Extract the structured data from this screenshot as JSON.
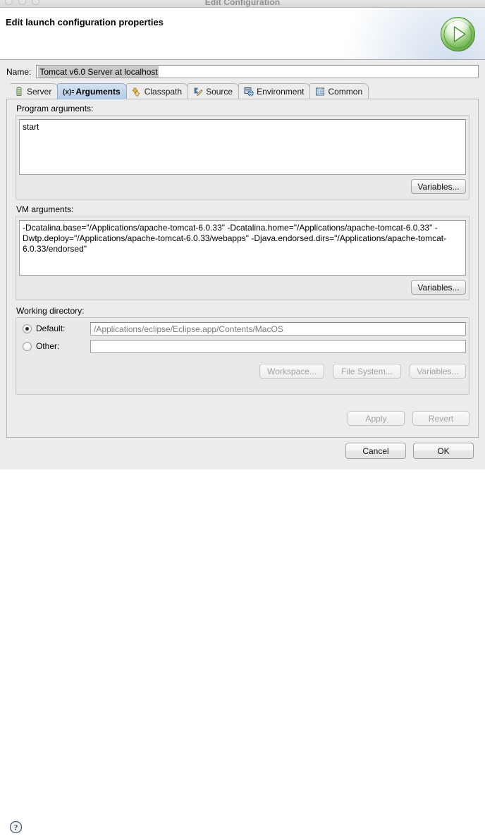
{
  "window": {
    "title": "Edit Configuration",
    "traffic_lights": [
      "close",
      "minimize",
      "zoom"
    ]
  },
  "banner": {
    "heading": "Edit launch configuration properties",
    "icon": "run-play-icon"
  },
  "name": {
    "label": "Name:",
    "value": "Tomcat v6.0 Server at localhost",
    "selected": true
  },
  "tabs": [
    {
      "id": "server",
      "label": "Server",
      "icon": "server-icon",
      "active": false
    },
    {
      "id": "arguments",
      "label": "Arguments",
      "icon": "variable-xy-icon",
      "active": true
    },
    {
      "id": "classpath",
      "label": "Classpath",
      "icon": "classpath-icon",
      "active": false
    },
    {
      "id": "source",
      "label": "Source",
      "icon": "source-edit-icon",
      "active": false
    },
    {
      "id": "environment",
      "label": "Environment",
      "icon": "environment-icon",
      "active": false
    },
    {
      "id": "common",
      "label": "Common",
      "icon": "common-list-icon",
      "active": false
    }
  ],
  "program_arguments": {
    "label": "Program arguments:",
    "value": "start",
    "variables_button": "Variables..."
  },
  "vm_arguments": {
    "label": "VM arguments:",
    "value": "-Dcatalina.base=\"/Applications/apache-tomcat-6.0.33\" -Dcatalina.home=\"/Applications/apache-tomcat-6.0.33\" -Dwtp.deploy=\"/Applications/apache-tomcat-6.0.33/webapps\" -Djava.endorsed.dirs=\"/Applications/apache-tomcat-6.0.33/endorsed\"",
    "variables_button": "Variables..."
  },
  "working_directory": {
    "label": "Working directory:",
    "default_radio_label": "Default:",
    "default_value": "/Applications/eclipse/Eclipse.app/Contents/MacOS",
    "default_selected": true,
    "other_radio_label": "Other:",
    "other_value": "",
    "other_selected": false,
    "buttons": [
      {
        "label": "Workspace...",
        "enabled": false
      },
      {
        "label": "File System...",
        "enabled": false
      },
      {
        "label": "Variables...",
        "enabled": false
      }
    ]
  },
  "form_buttons": [
    {
      "id": "apply",
      "label": "Apply",
      "enabled": false
    },
    {
      "id": "revert",
      "label": "Revert",
      "enabled": false
    }
  ],
  "dialog_buttons": [
    {
      "id": "cancel",
      "label": "Cancel",
      "enabled": true,
      "default": false
    },
    {
      "id": "ok",
      "label": "OK",
      "enabled": true,
      "default": true
    }
  ],
  "help": {
    "icon": "help-question-icon"
  },
  "colors": {
    "window_bg": "#ececec",
    "banner_bg": "#ffffff",
    "active_tab_top": "#d5e2f1",
    "active_tab_bottom": "#b3cbe8",
    "selection": "#c9c9c9",
    "run_green": "#7cbf5a",
    "border": "#b5b5b5"
  }
}
